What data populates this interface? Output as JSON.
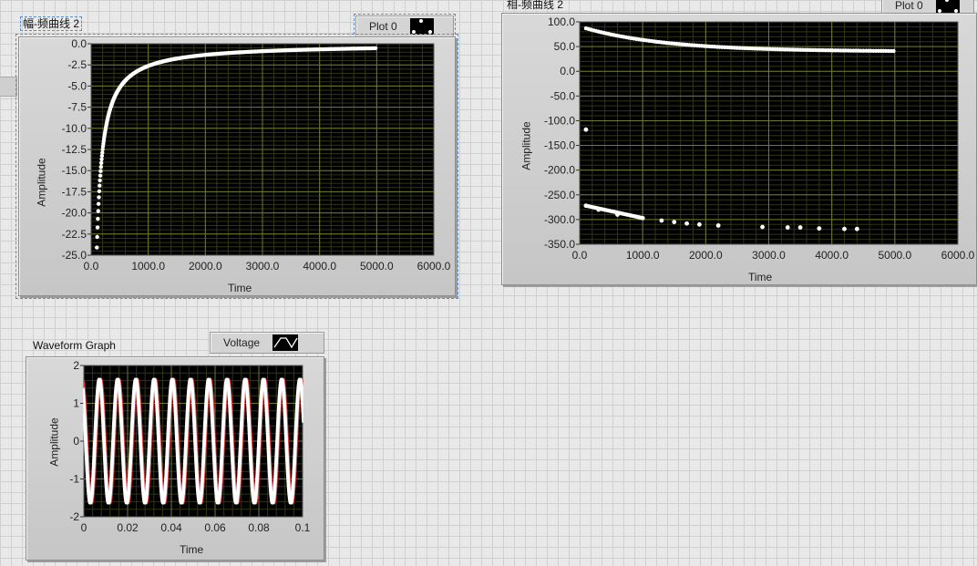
{
  "amplitude_graph": {
    "label": "幅-频曲线 2",
    "legend_plot": "Plot 0",
    "xlabel": "Time",
    "ylabel": "Amplitude",
    "x_ticks": [
      "0.0",
      "1000.0",
      "2000.0",
      "3000.0",
      "4000.0",
      "5000.0",
      "6000.0"
    ],
    "y_ticks": [
      "0.0",
      "-2.5",
      "-5.0",
      "-7.5",
      "-10.0",
      "-12.5",
      "-15.0",
      "-17.5",
      "-20.0",
      "-22.5",
      "-25.0"
    ],
    "xlim": [
      0,
      6000
    ],
    "ylim": [
      -25,
      0
    ],
    "plot_color": "#ffffff",
    "grid_color": "#6f7a2a"
  },
  "phase_graph": {
    "label": "相-频曲线 2",
    "legend_plot": "Plot 0",
    "xlabel": "Time",
    "ylabel": "Amplitude",
    "x_ticks": [
      "0.0",
      "1000.0",
      "2000.0",
      "3000.0",
      "4000.0",
      "5000.0",
      "6000.0"
    ],
    "y_ticks": [
      "100.0",
      "50.0",
      "0.0",
      "-50.0",
      "-100.0",
      "-150.0",
      "-200.0",
      "-250.0",
      "-300.0",
      "-350.0"
    ],
    "xlim": [
      0,
      6000
    ],
    "ylim": [
      -350,
      100
    ],
    "plot_color": "#ffffff",
    "grid_color": "#6f7a2a"
  },
  "waveform_graph": {
    "label": "Waveform Graph",
    "legend_plot": "Voltage",
    "xlabel": "Time",
    "ylabel": "Amplitude",
    "x_ticks": [
      "0",
      "0.02",
      "0.04",
      "0.06",
      "0.08",
      "0.1"
    ],
    "y_ticks": [
      "2",
      "1",
      "0",
      "-1",
      "-2"
    ],
    "xlim": [
      0,
      0.1
    ],
    "ylim": [
      -2,
      2
    ],
    "plot_color": "#ffffff",
    "second_color": "#e04040",
    "grid_color": "#6f7a2a"
  },
  "chart_data": [
    {
      "type": "scatter",
      "title": "幅-频曲线 2",
      "xlabel": "Time",
      "ylabel": "Amplitude",
      "xlim": [
        0,
        6000
      ],
      "ylim": [
        -25,
        0
      ],
      "series": [
        {
          "name": "Plot 0",
          "x": [
            100,
            150,
            200,
            300,
            400,
            500,
            700,
            1000,
            1500,
            2000,
            2500,
            3000,
            3500,
            4000,
            4500,
            5000
          ],
          "y": [
            -24.2,
            -20.5,
            -17.8,
            -14,
            -11.6,
            -9.8,
            -7.5,
            -5.5,
            -3.8,
            -2.8,
            -2.2,
            -1.7,
            -1.4,
            -1.1,
            -0.8,
            -0.5
          ]
        }
      ],
      "grid": true
    },
    {
      "type": "scatter",
      "title": "相-频曲线 2",
      "xlabel": "Time",
      "ylabel": "Amplitude",
      "xlim": [
        0,
        6000
      ],
      "ylim": [
        -350,
        100
      ],
      "series": [
        {
          "name": "Plot 0",
          "x": [
            100,
            500,
            1000,
            1500,
            2000,
            2500,
            3000,
            3500,
            4000,
            4500,
            5000
          ],
          "y": [
            85,
            72,
            62,
            54,
            49,
            45,
            43,
            42,
            41,
            40,
            40
          ]
        },
        {
          "x": [
            100
          ],
          "y": [
            -118
          ]
        },
        {
          "x": [
            100,
            300,
            600,
            1000,
            1300,
            1500,
            1700,
            1900,
            2200,
            2900,
            3300,
            3500,
            3800,
            4200,
            4400
          ],
          "y": [
            -272,
            -280,
            -290,
            -297,
            -302,
            -305,
            -308,
            -310,
            -312,
            -315,
            -316,
            -316,
            -318,
            -319,
            -319
          ]
        }
      ],
      "grid": true
    },
    {
      "type": "line",
      "title": "Waveform Graph",
      "xlabel": "Time",
      "ylabel": "Amplitude",
      "xlim": [
        0,
        0.1
      ],
      "ylim": [
        -2,
        2
      ],
      "series": [
        {
          "name": "Voltage",
          "frequency_hz": 120,
          "amplitude": 1.65
        }
      ],
      "grid": true
    }
  ]
}
